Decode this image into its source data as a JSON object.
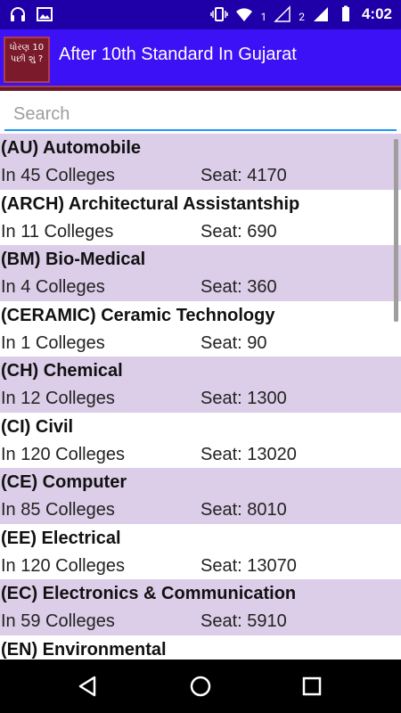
{
  "statusbar": {
    "time": "4:02",
    "sim1": "1",
    "sim2": "2"
  },
  "toolbar": {
    "app_icon_text": "ધોરણ 10 પછી શું ?",
    "title": "After 10th Standard In Gujarat"
  },
  "search": {
    "placeholder": "Search"
  },
  "colors": {
    "statusbar": "#1f00a8",
    "toolbar": "#3d11f5",
    "divider": "#6b1a2b",
    "row_odd": "#dccde8",
    "row_even": "#ffffff",
    "search_underline": "#2196f3"
  },
  "list": {
    "items": [
      {
        "title": "(AU) Automobile",
        "colleges": "In 45 Colleges",
        "seat": "Seat: 4170"
      },
      {
        "title": "(ARCH) Architectural Assistantship",
        "colleges": "In 11 Colleges",
        "seat": "Seat: 690"
      },
      {
        "title": "(BM) Bio-Medical",
        "colleges": "In 4 Colleges",
        "seat": "Seat: 360"
      },
      {
        "title": "(CERAMIC) Ceramic Technology",
        "colleges": "In 1 Colleges",
        "seat": "Seat: 90"
      },
      {
        "title": "(CH) Chemical",
        "colleges": "In 12 Colleges",
        "seat": "Seat: 1300"
      },
      {
        "title": "(CI) Civil",
        "colleges": "In 120 Colleges",
        "seat": "Seat: 13020"
      },
      {
        "title": "(CE) Computer",
        "colleges": "In 85 Colleges",
        "seat": "Seat: 8010"
      },
      {
        "title": "(EE) Electrical",
        "colleges": "In 120 Colleges",
        "seat": "Seat: 13070"
      },
      {
        "title": "(EC) Electronics & Communication",
        "colleges": "In 59 Colleges",
        "seat": "Seat: 5910"
      },
      {
        "title": "(EN) Environmental",
        "colleges": "",
        "seat": ""
      }
    ]
  },
  "navbar": {
    "icons": [
      "back-icon",
      "home-icon",
      "recents-icon"
    ]
  }
}
